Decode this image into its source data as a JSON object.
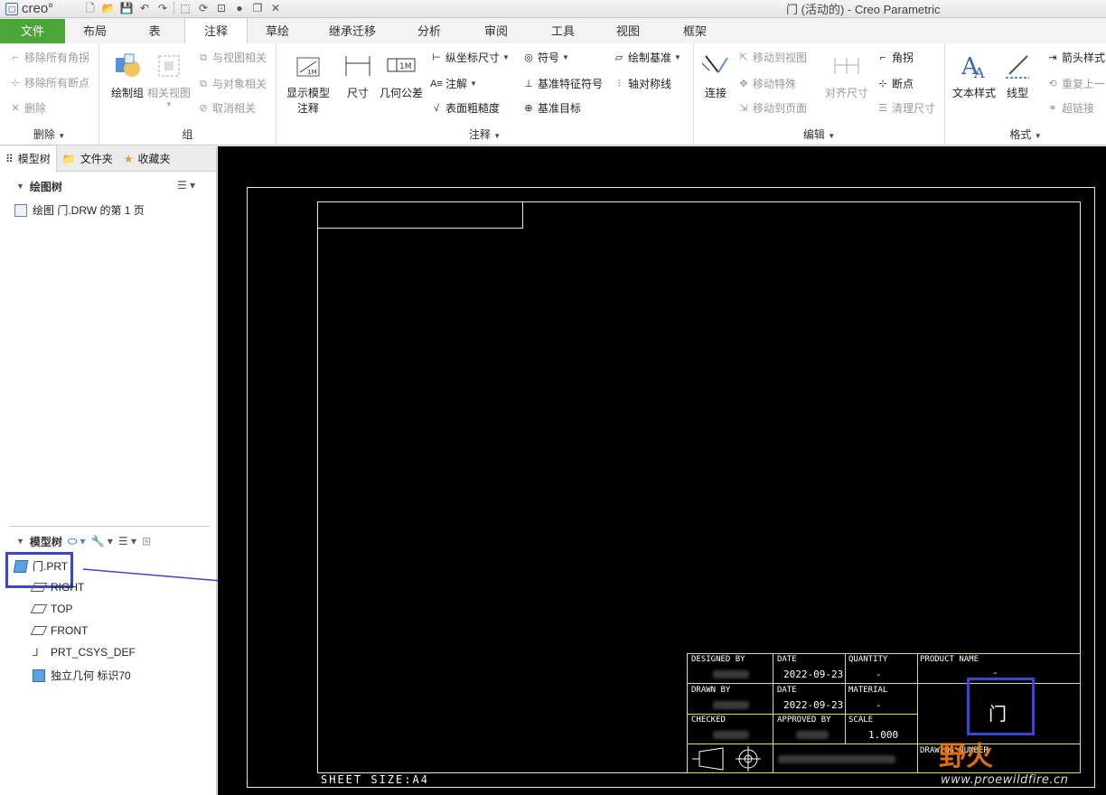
{
  "app": {
    "logo_text": "creo°",
    "window_title": "门 (活动的) - Creo Parametric"
  },
  "tabs": [
    {
      "label": "文件"
    },
    {
      "label": "布局"
    },
    {
      "label": "表"
    },
    {
      "label": "注释"
    },
    {
      "label": "草绘"
    },
    {
      "label": "继承迁移"
    },
    {
      "label": "分析"
    },
    {
      "label": "审阅"
    },
    {
      "label": "工具"
    },
    {
      "label": "视图"
    },
    {
      "label": "框架"
    }
  ],
  "ribbon": {
    "delete_group": {
      "label": "删除",
      "remove_all_angles": "移除所有角拐",
      "remove_all_breaks": "移除所有断点",
      "delete": "删除"
    },
    "group_group": {
      "label": "组",
      "draw_group": "绘制组",
      "related_view": "相关视图",
      "relate_to_view": "与视图相关",
      "relate_to_object": "与对象相关",
      "unrelate": "取消相关"
    },
    "annotate_group": {
      "label": "注释",
      "show_model_annotations_1": "显示模型",
      "show_model_annotations_2": "注释",
      "dimension": "尺寸",
      "gtol": "几何公差",
      "ordinate_dimension": "纵坐标尺寸",
      "note": "注解",
      "surface_finish": "表面粗糙度",
      "symbol": "符号",
      "datum_feature_symbol": "基准特征符号",
      "datum_target": "基准目标",
      "draw_datum": "绘制基准",
      "axis_symmetry": "轴对称线"
    },
    "edit_group": {
      "label": "编辑",
      "connect": "连接",
      "move_to_view": "移动到视图",
      "move_special": "移动特殊",
      "move_to_page": "移动到页面",
      "align_dimension": "对齐尺寸",
      "angle_corner": "角拐",
      "break_point": "断点",
      "clean_dimension": "清理尺寸"
    },
    "format_group": {
      "label": "格式",
      "text_style": "文本样式",
      "line_style": "线型",
      "arrow_style": "箭头样式",
      "repeat_last": "重复上一",
      "hyperlink": "超链接"
    }
  },
  "left_panel": {
    "tabs": [
      {
        "label": "模型树"
      },
      {
        "label": "文件夹"
      },
      {
        "label": "收藏夹"
      }
    ],
    "drawing_tree": {
      "header": "绘图树",
      "items": [
        {
          "label": "绘图 门.DRW 的第 1 页"
        }
      ]
    },
    "model_tree": {
      "header": "模型树",
      "items": [
        {
          "label": "门.PRT"
        },
        {
          "label": "RIGHT"
        },
        {
          "label": "TOP"
        },
        {
          "label": "FRONT"
        },
        {
          "label": "PRT_CSYS_DEF"
        },
        {
          "label": "独立几何 标识70"
        }
      ]
    }
  },
  "drawing": {
    "sheet_size": "SHEET SIZE:A4",
    "title_block": {
      "designed_by": "DESIGNED BY",
      "date_1": "DATE",
      "date_1_value": "2022-09-23",
      "quantity": "QUANTITY",
      "quantity_value": "-",
      "product_name": "PRODUCT NAME",
      "product_name_value": "-",
      "drawn_by": "DRAWN BY",
      "date_2": "DATE",
      "date_2_value": "2022-09-23",
      "material": "MATERIAL",
      "material_value": "-",
      "part_name": "门",
      "checked": "CHECKED",
      "approved_by": "APPROVED BY",
      "scale": "SCALE",
      "scale_value": "1.000",
      "drawing_number": "DRAWING NUMBER"
    },
    "watermark": {
      "brand": "野火",
      "url": "www.proewildfire.cn"
    }
  },
  "colors": {
    "file_tab": "#4aa635",
    "highlight": "#3d47c4",
    "title_block_lines": "#e8e04a",
    "watermark_orange": "#f07a1a"
  }
}
